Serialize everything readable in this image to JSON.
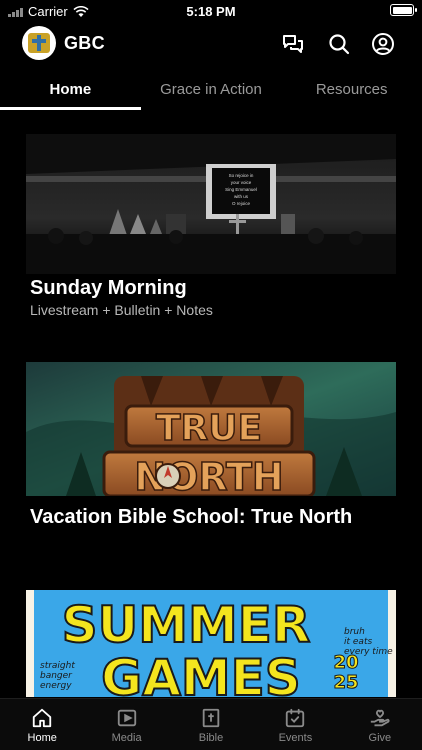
{
  "status_bar": {
    "carrier": "Carrier",
    "time": "5:18 PM"
  },
  "header": {
    "brand": "GBC",
    "icons": [
      "chat-icon",
      "search-icon",
      "profile-icon"
    ]
  },
  "tabs": [
    {
      "label": "Home",
      "active": true
    },
    {
      "label": "Grace in Action",
      "active": false
    },
    {
      "label": "Resources",
      "active": false
    }
  ],
  "cards": [
    {
      "title": "Sunday Morning",
      "subtitle": "Livestream + Bulletin + Notes",
      "image_text": "So rejoice in your voice sing Emmanuel with us O rejoice"
    },
    {
      "title": "Vacation Bible School: True North",
      "image_lines": [
        "TRUE",
        "NORTH"
      ]
    },
    {
      "image_lines": [
        "SUMMER",
        "GAMES"
      ],
      "image_year": "2025",
      "image_left_note": "straight banger energy",
      "image_right_note": "bruh it eats every time"
    }
  ],
  "bottom_nav": [
    {
      "label": "Home",
      "icon": "home-icon",
      "active": true
    },
    {
      "label": "Media",
      "icon": "media-icon",
      "active": false
    },
    {
      "label": "Bible",
      "icon": "bible-icon",
      "active": false
    },
    {
      "label": "Events",
      "icon": "calendar-icon",
      "active": false
    },
    {
      "label": "Give",
      "icon": "give-icon",
      "active": false
    }
  ],
  "colors": {
    "background": "#000000",
    "active_text": "#ffffff",
    "inactive_text": "#9a9a9a",
    "brand_gold": "#c9a227",
    "games_yellow": "#f4e51e",
    "games_blue": "#3aa7e8"
  }
}
